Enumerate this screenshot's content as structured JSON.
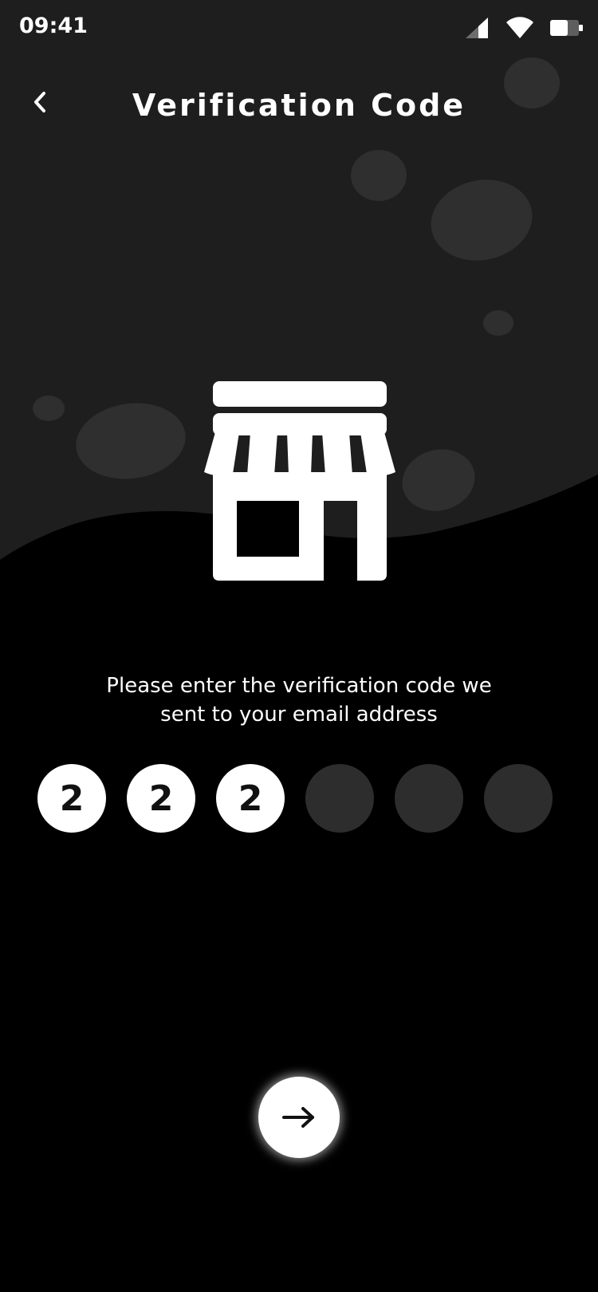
{
  "status_bar": {
    "time": "09:41",
    "icons": [
      "signal-icon",
      "wifi-icon",
      "battery-icon"
    ]
  },
  "header": {
    "back_icon": "chevron-left-icon",
    "title": "Verification Code"
  },
  "illustration": {
    "icon": "store-icon"
  },
  "instruction": {
    "line1": "Please enter the verification code we",
    "line2": "sent to your email address"
  },
  "code_inputs": [
    {
      "value": "2",
      "filled": true
    },
    {
      "value": "2",
      "filled": true
    },
    {
      "value": "2",
      "filled": true
    },
    {
      "value": "",
      "filled": false
    },
    {
      "value": "",
      "filled": false
    },
    {
      "value": "",
      "filled": false
    }
  ],
  "next_button": {
    "icon": "arrow-right-icon"
  },
  "colors": {
    "background_dark": "#000000",
    "background_top": "#1e1e1e",
    "blob": "#2f2f2f",
    "empty_input": "#2d2d2d",
    "text": "#ffffff"
  }
}
